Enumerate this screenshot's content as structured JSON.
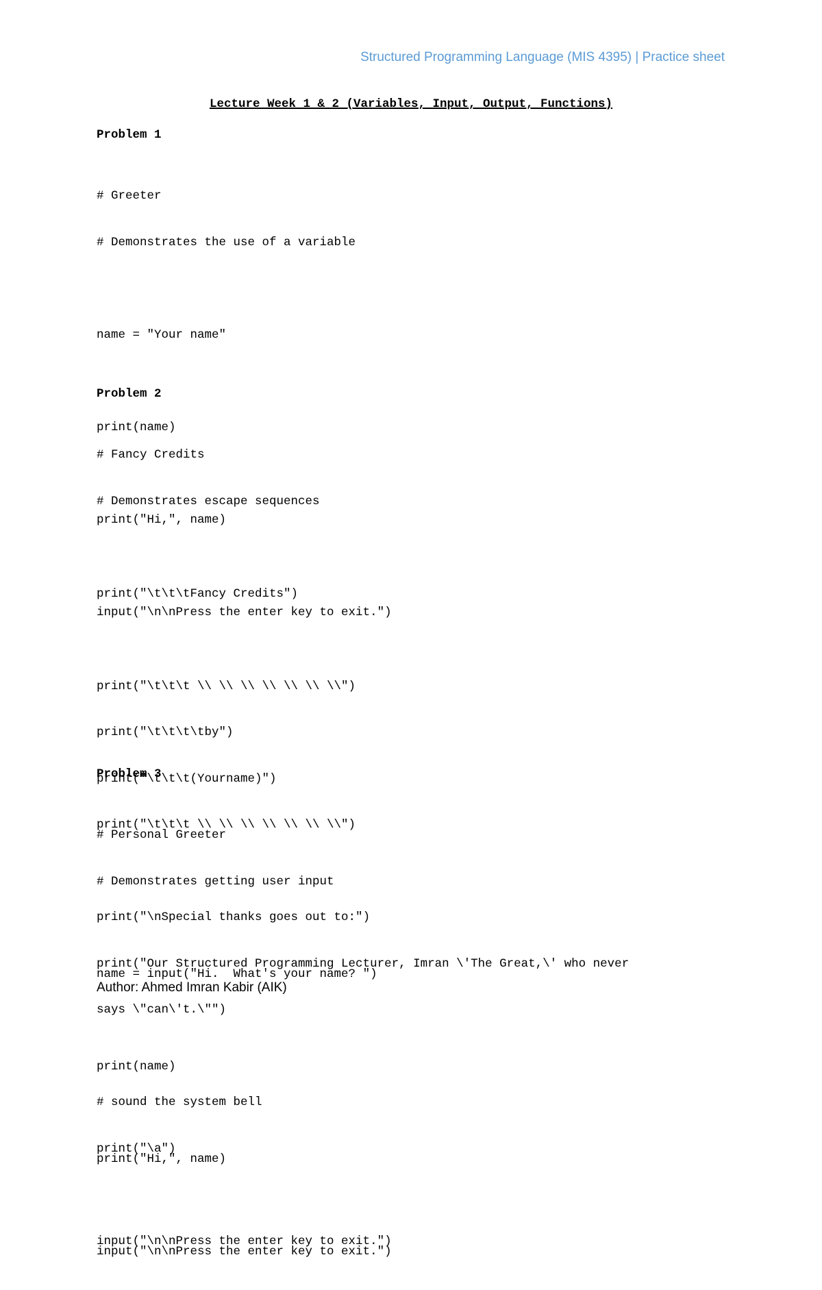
{
  "header": {
    "text": "Structured Programming Language (MIS 4395) | Practice sheet",
    "color": "#5b9bd5"
  },
  "title": "Lecture Week 1 & 2 (Variables, Input, Output, Functions)",
  "problems": [
    {
      "title": "Problem 1",
      "groups": [
        [
          "# Greeter",
          "# Demonstrates the use of a variable"
        ],
        [
          "name = \"Your name\""
        ],
        [
          "print(name)"
        ],
        [
          "print(\"Hi,\", name)"
        ],
        [
          "input(\"\\n\\nPress the enter key to exit.\")"
        ]
      ]
    },
    {
      "title": "Problem 2",
      "groups": [
        [
          "# Fancy Credits",
          "# Demonstrates escape sequences"
        ],
        [
          "print(\"\\t\\t\\tFancy Credits\")"
        ],
        [
          "print(\"\\t\\t\\t \\\\ \\\\ \\\\ \\\\ \\\\ \\\\ \\\\\")",
          "print(\"\\t\\t\\t\\tby\")",
          "print(\"\\t\\t\\t(Yourname)\")",
          "print(\"\\t\\t\\t \\\\ \\\\ \\\\ \\\\ \\\\ \\\\ \\\\\")"
        ],
        [
          "print(\"\\nSpecial thanks goes out to:\")",
          "print(\"Our Structured Programming Lecturer, Imran \\'The Great,\\' who never",
          "says \\\"can\\'t.\\\"\")"
        ],
        [
          "# sound the system bell",
          "print(\"\\a\")"
        ],
        [
          "input(\"\\n\\nPress the enter key to exit.\")"
        ]
      ]
    },
    {
      "title": "Problem 3",
      "groups": [
        [
          "# Personal Greeter",
          "# Demonstrates getting user input"
        ],
        [
          "name = input(\"Hi.  What's your name? \")"
        ],
        [
          "print(name)"
        ],
        [
          "print(\"Hi,\", name)"
        ],
        [
          "input(\"\\n\\nPress the enter key to exit.\")"
        ]
      ]
    }
  ],
  "author": "Author: Ahmed Imran Kabir (AIK)"
}
